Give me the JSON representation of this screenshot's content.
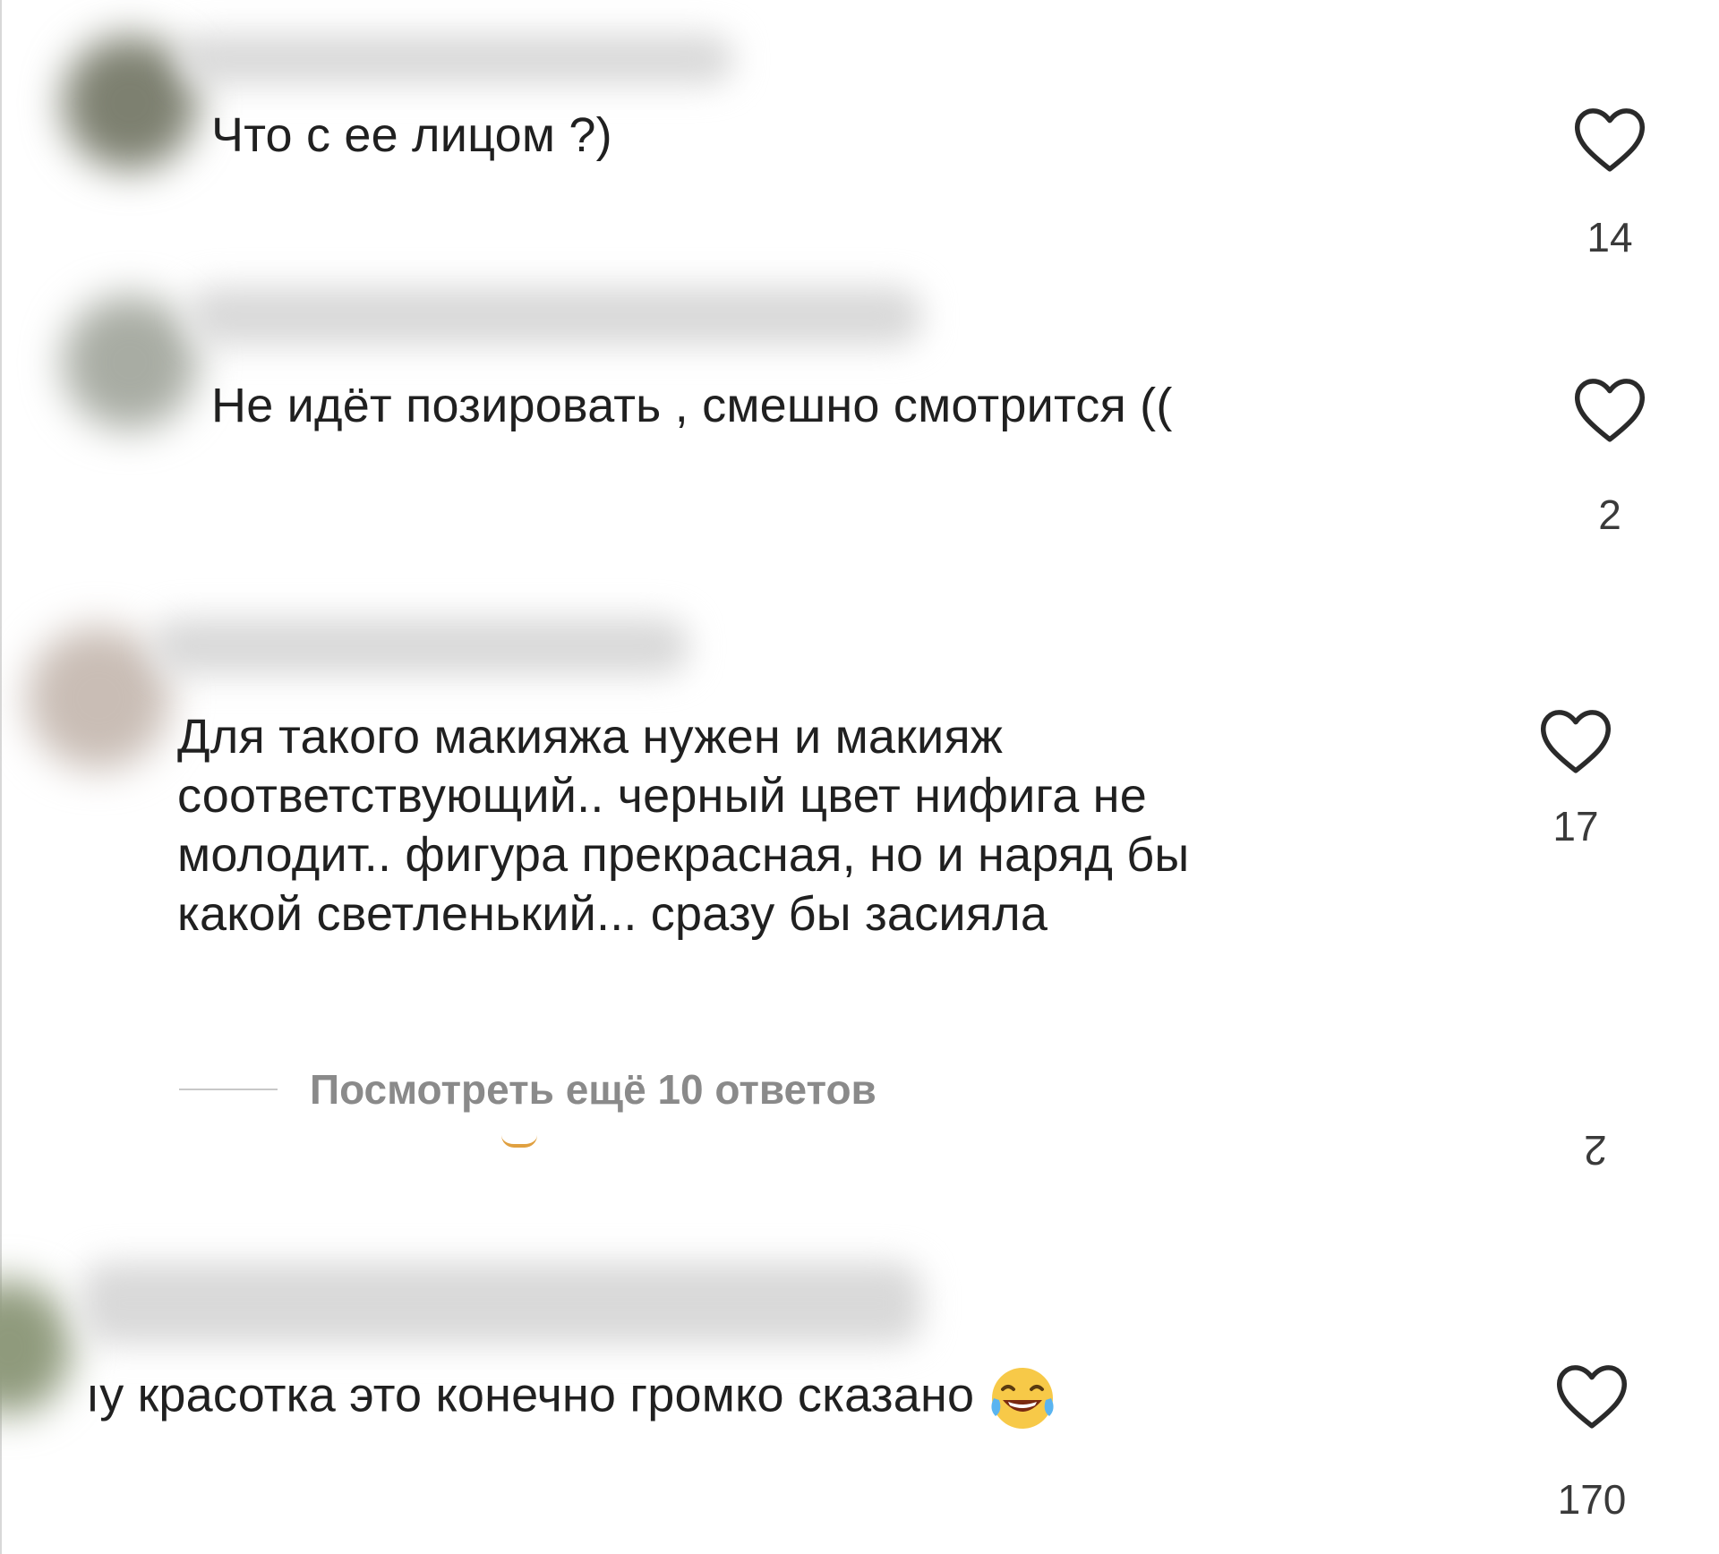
{
  "comments": [
    {
      "text": "Что с ее лицом ?)",
      "likes": "14"
    },
    {
      "text": "Не идёт позировать , смешно смотрится ((",
      "likes": "2"
    },
    {
      "lines": [
        "Для такого макияжа нужен и макияж",
        "соответствующий.. черный цвет нифига не",
        "молодит.. фигура прекрасная, но и наряд бы",
        "какой светленький... сразу бы засияла"
      ],
      "likes": "17"
    },
    {
      "text": "ıу красотка это конечно громко сказано",
      "likes": "170",
      "emoji": "tears-of-joy-emoji"
    }
  ],
  "replies": {
    "label": "Посмотреть ещё 10 ответов"
  },
  "partial_count": "2",
  "colors": {
    "text": "#202020",
    "muted": "#8a8a8a",
    "heart_stroke": "#2a2a2a"
  }
}
